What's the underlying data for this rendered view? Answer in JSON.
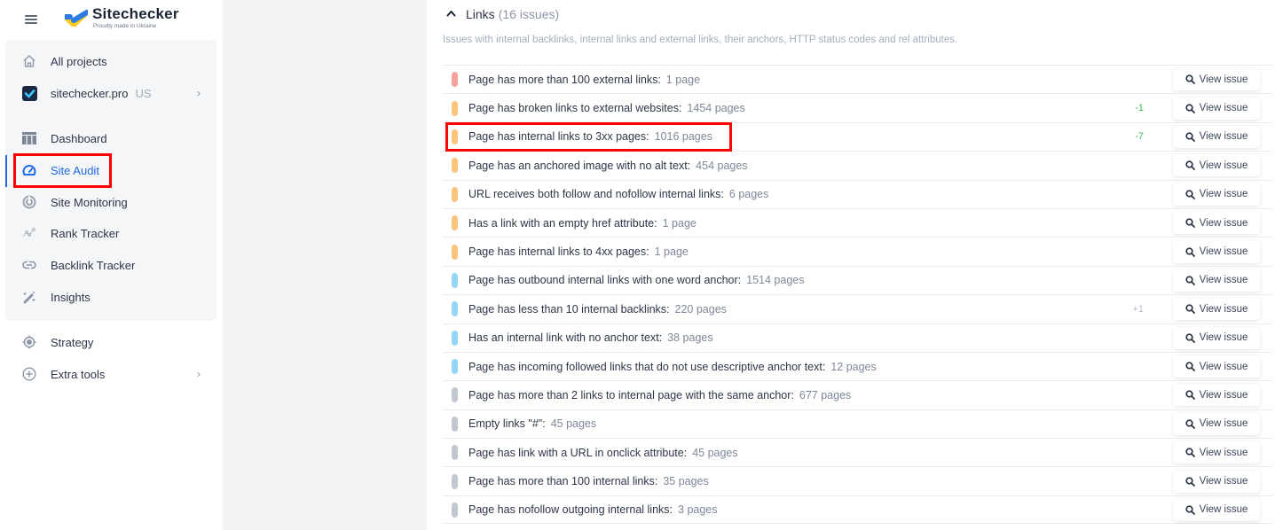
{
  "brand": {
    "name": "Sitechecker",
    "tagline": "Proudly made in Ukraine"
  },
  "sidebar": {
    "top_items": [
      {
        "label": "All projects",
        "icon": "home-icon"
      },
      {
        "label": "sitechecker.pro",
        "sub": "US",
        "icon": "project-logo-icon",
        "chevron": "›"
      }
    ],
    "items": [
      {
        "label": "Dashboard",
        "icon": "dashboard-icon"
      },
      {
        "label": "Site Audit",
        "icon": "gauge-icon",
        "active": true
      },
      {
        "label": "Site Monitoring",
        "icon": "monitoring-icon"
      },
      {
        "label": "Rank Tracker",
        "icon": "rank-tracker-icon"
      },
      {
        "label": "Backlink Tracker",
        "icon": "link-icon"
      },
      {
        "label": "Insights",
        "icon": "magic-wand-icon"
      }
    ],
    "bottom_items": [
      {
        "label": "Strategy",
        "icon": "target-icon"
      },
      {
        "label": "Extra tools",
        "icon": "plus-circle-icon",
        "chevron": "›"
      }
    ]
  },
  "section": {
    "caret": "^",
    "title": "Links",
    "count": "(16 issues)",
    "description": "Issues with internal backlinks, internal links and external links, their anchors, HTTP status codes and rel attributes."
  },
  "colors": {
    "error": "#f4a29a",
    "warning": "#fbc57d",
    "notice": "#93d6f5",
    "info": "#c3c8d0",
    "delta_good": "#2fbf5b",
    "delta_neutral": "#b4bbc6",
    "accent": "#1f6ae6"
  },
  "button_label": "View issue",
  "issues": [
    {
      "title": "Page has more than 100 external links:",
      "pages": "1 page",
      "severity": "error",
      "delta": ""
    },
    {
      "title": "Page has broken links to external websites:",
      "pages": "1454 pages",
      "severity": "warning",
      "delta": "-1",
      "delta_type": "good"
    },
    {
      "title": "Page has internal links to 3xx pages:",
      "pages": "1016 pages",
      "severity": "warning",
      "delta": "-7",
      "delta_type": "good",
      "highlighted": true
    },
    {
      "title": "Page has an anchored image with no alt text:",
      "pages": "454 pages",
      "severity": "warning",
      "delta": ""
    },
    {
      "title": "URL receives both follow and nofollow internal links:",
      "pages": "6 pages",
      "severity": "warning",
      "delta": ""
    },
    {
      "title": "Has a link with an empty href attribute:",
      "pages": "1 page",
      "severity": "warning",
      "delta": ""
    },
    {
      "title": "Page has internal links to 4xx pages:",
      "pages": "1 page",
      "severity": "warning",
      "delta": ""
    },
    {
      "title": "Page has outbound internal links with one word anchor:",
      "pages": "1514 pages",
      "severity": "notice",
      "delta": ""
    },
    {
      "title": "Page has less than 10 internal backlinks:",
      "pages": "220 pages",
      "severity": "notice",
      "delta": "+1",
      "delta_type": "neutral"
    },
    {
      "title": "Has an internal link with no anchor text:",
      "pages": "38 pages",
      "severity": "notice",
      "delta": ""
    },
    {
      "title": "Page has incoming followed links that do not use descriptive anchor text:",
      "pages": "12 pages",
      "severity": "notice",
      "delta": ""
    },
    {
      "title": "Page has more than 2 links to internal page with the same anchor:",
      "pages": "677 pages",
      "severity": "info",
      "delta": ""
    },
    {
      "title": "Empty links \"#\":",
      "pages": "45 pages",
      "severity": "info",
      "delta": ""
    },
    {
      "title": "Page has link with a URL in onclick attribute:",
      "pages": "45 pages",
      "severity": "info",
      "delta": ""
    },
    {
      "title": "Page has more than 100 internal links:",
      "pages": "35 pages",
      "severity": "info",
      "delta": ""
    },
    {
      "title": "Page has nofollow outgoing internal links:",
      "pages": "3 pages",
      "severity": "info",
      "delta": ""
    }
  ]
}
